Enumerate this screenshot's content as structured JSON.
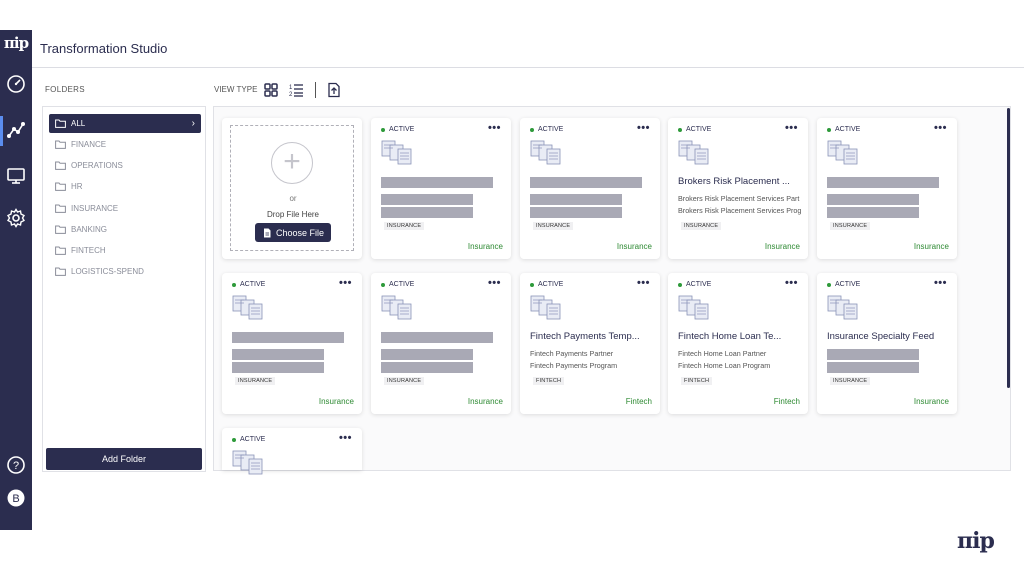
{
  "app": {
    "logo": "πip",
    "title": "Transformation Studio",
    "brand": "πip"
  },
  "folders": {
    "label": "FOLDERS",
    "items": [
      {
        "label": "ALL"
      },
      {
        "label": "FINANCE"
      },
      {
        "label": "OPERATIONS"
      },
      {
        "label": "HR"
      },
      {
        "label": "INSURANCE"
      },
      {
        "label": "BANKING"
      },
      {
        "label": "FINTECH"
      },
      {
        "label": "LOGISTICS-SPEND"
      }
    ],
    "active_index": 0,
    "add_folder_label": "Add Folder"
  },
  "toolbar": {
    "view_type_label": "VIEW TYPE"
  },
  "upload": {
    "or_text": "or",
    "drop_text": "Drop File Here",
    "choose_label": "Choose File"
  },
  "status_label": "ACTIVE",
  "menu_glyph": "•••",
  "cards": [
    {
      "title": "",
      "line1": "",
      "line2": "",
      "tag": "INSURANCE",
      "category": "Insurance"
    },
    {
      "title": "",
      "line1": "",
      "line2": "",
      "tag": "INSURANCE",
      "category": "Insurance"
    },
    {
      "title": "Brokers Risk Placement ...",
      "line1": "Brokers Risk Placement Services Part",
      "line2": "Brokers Risk Placement Services Prog",
      "tag": "INSURANCE",
      "category": "Insurance"
    },
    {
      "title": "",
      "line1": "",
      "line2": "",
      "tag": "INSURANCE",
      "category": "Insurance"
    },
    {
      "title": "",
      "line1": "",
      "line2": "",
      "tag": "INSURANCE",
      "category": "Insurance"
    },
    {
      "title": "",
      "line1": "",
      "line2": "",
      "tag": "INSURANCE",
      "category": "Insurance"
    },
    {
      "title": "Fintech Payments Temp...",
      "line1": "Fintech Payments Partner",
      "line2": "Fintech Payments Program",
      "tag": "FINTECH",
      "category": "Fintech"
    },
    {
      "title": "Fintech Home Loan Te...",
      "line1": "Fintech Home Loan Partner",
      "line2": "Fintech Home Loan Program",
      "tag": "FINTECH",
      "category": "Fintech"
    },
    {
      "title": "Insurance Specialty Feed",
      "line1": "",
      "line2": "",
      "tag": "INSURANCE",
      "category": "Insurance"
    },
    {
      "title": "",
      "line1": "",
      "line2": "",
      "tag": "",
      "category": ""
    }
  ],
  "colors": {
    "primary": "#2b2d4f",
    "active_dot": "#2e9a3a",
    "category_text": "#2e8a33",
    "placeholder_bar": "#a9a9b5"
  },
  "icons": {
    "nav": [
      "gauge-icon",
      "workflow-icon",
      "monitor-icon",
      "gear-icon",
      "help-icon",
      "user-avatar-icon"
    ]
  }
}
